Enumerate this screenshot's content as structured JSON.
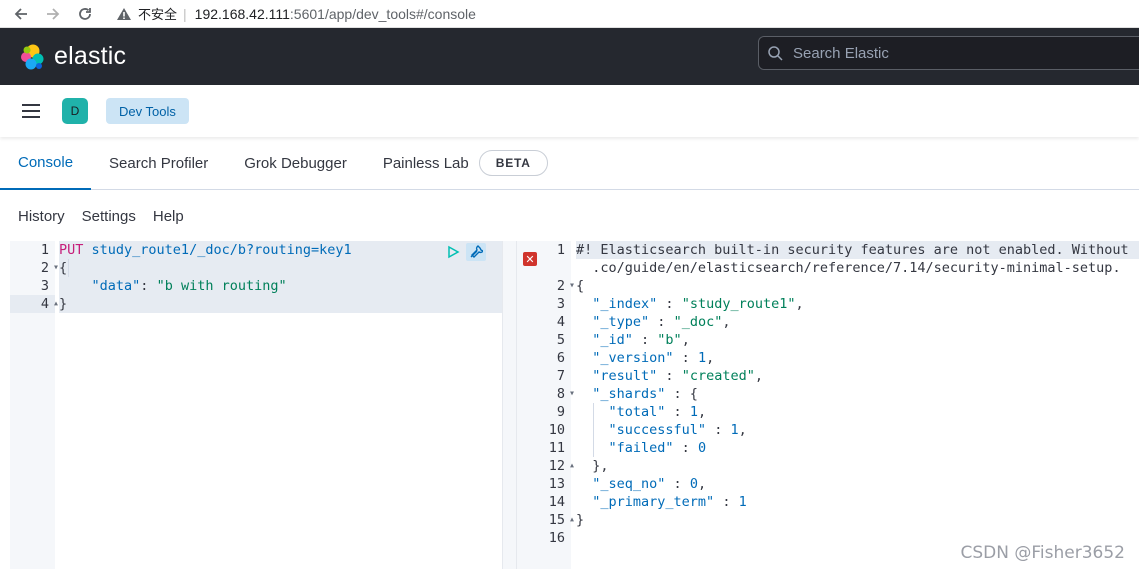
{
  "browser": {
    "insecure_label": "不安全",
    "url_host": "192.168.42.111",
    "url_path": ":5601/app/dev_tools#/console"
  },
  "header": {
    "logo_text": "elastic",
    "search_placeholder": "Search Elastic"
  },
  "breadcrumb": {
    "avatar_letter": "D",
    "current": "Dev Tools"
  },
  "tabs": [
    {
      "label": "Console",
      "active": true
    },
    {
      "label": "Search Profiler"
    },
    {
      "label": "Grok Debugger"
    },
    {
      "label": "Painless Lab"
    }
  ],
  "beta_badge": "BETA",
  "menu": [
    "History",
    "Settings",
    "Help"
  ],
  "request": {
    "line_numbers": [
      "1",
      "2",
      "3",
      "4"
    ],
    "method": "PUT",
    "url": "study_route1/_doc/b?routing=key1",
    "open_brace": "{",
    "body_key": "\"data\"",
    "body_colon": ": ",
    "body_value": "\"b with routing\"",
    "close_brace": "}"
  },
  "response": {
    "line_numbers": [
      "1",
      "2",
      "3",
      "4",
      "5",
      "6",
      "7",
      "8",
      "9",
      "10",
      "11",
      "12",
      "13",
      "14",
      "15",
      "16"
    ],
    "warning_line1": "#! Elasticsearch built-in security features are not enabled. Without",
    "warning_line2": ".co/guide/en/elasticsearch/reference/7.14/security-minimal-setup.",
    "lines": {
      "open": "{",
      "index_key": "\"_index\"",
      "index_val": "\"study_route1\"",
      "type_key": "\"_type\"",
      "type_val": "\"_doc\"",
      "id_key": "\"_id\"",
      "id_val": "\"b\"",
      "version_key": "\"_version\"",
      "version_val": "1",
      "result_key": "\"result\"",
      "result_val": "\"created\"",
      "shards_key": "\"_shards\"",
      "total_key": "\"total\"",
      "total_val": "1",
      "successful_key": "\"successful\"",
      "successful_val": "1",
      "failed_key": "\"failed\"",
      "failed_val": "0",
      "shards_close": "},",
      "seq_key": "\"_seq_no\"",
      "seq_val": "0",
      "primary_key": "\"_primary_term\"",
      "primary_val": "1",
      "close": "}"
    }
  },
  "watermark": "CSDN @Fisher3652"
}
